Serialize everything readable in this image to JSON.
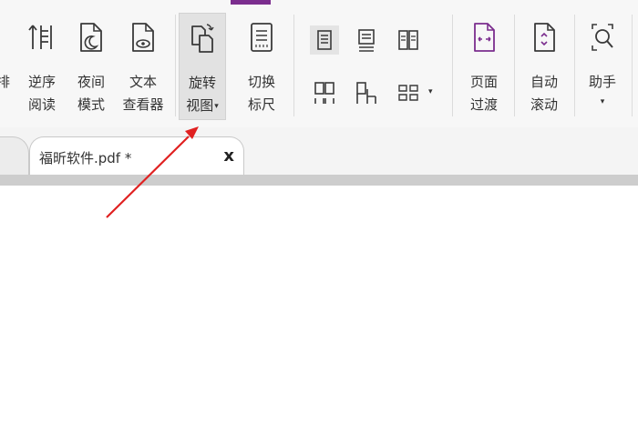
{
  "theme": {
    "accent": "#7b2d8e",
    "icon_color": "#3a3a3a",
    "arrow_color": "#e02020"
  },
  "toolbar": {
    "reverse_order_read": {
      "line1": "逆序",
      "line2": "阅读"
    },
    "night_mode": {
      "line1": "夜间",
      "line2": "模式"
    },
    "text_viewer": {
      "line1": "文本",
      "line2": "查看器"
    },
    "rotate_view": {
      "line1": "旋转",
      "line2": "视图",
      "caret": "▾"
    },
    "switch_ruler": {
      "line1": "切换",
      "line2": "标尺"
    },
    "page_transition": {
      "line1": "页面",
      "line2": "过渡"
    },
    "auto_scroll": {
      "line1": "自动",
      "line2": "滚动"
    },
    "assistant": {
      "line1": "助手",
      "caret": "▾"
    },
    "partial_left": "排",
    "layout_caret": "▾"
  },
  "tabs": {
    "document_title": "福昕软件.pdf *",
    "close_glyph": "x"
  }
}
